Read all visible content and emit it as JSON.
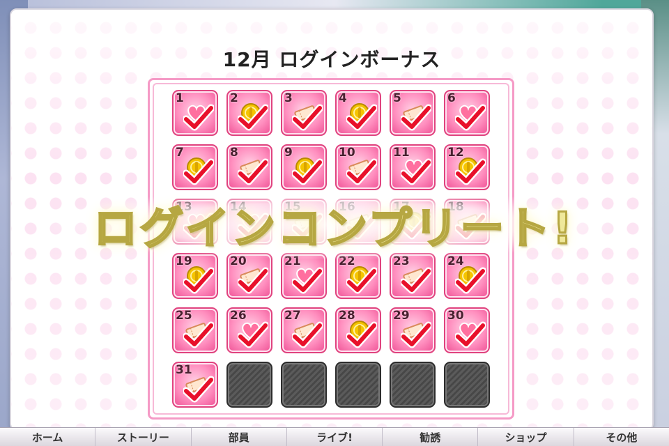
{
  "dialog": {
    "title": "12月 ログインボーナス"
  },
  "banner": {
    "text": "ログインコンプリート!"
  },
  "calendar": {
    "days": [
      {
        "day": "1",
        "reward": "heart-icon",
        "claimed": true
      },
      {
        "day": "2",
        "reward": "coin-icon",
        "claimed": true
      },
      {
        "day": "3",
        "reward": "ticket-icon",
        "claimed": true
      },
      {
        "day": "4",
        "reward": "coin-icon",
        "claimed": true
      },
      {
        "day": "5",
        "reward": "ticket-icon",
        "claimed": true
      },
      {
        "day": "6",
        "reward": "heart-icon",
        "claimed": true
      },
      {
        "day": "7",
        "reward": "coin-icon",
        "claimed": true
      },
      {
        "day": "8",
        "reward": "ticket-icon",
        "claimed": true
      },
      {
        "day": "9",
        "reward": "coin-icon",
        "claimed": true
      },
      {
        "day": "10",
        "reward": "ticket-icon",
        "claimed": true
      },
      {
        "day": "11",
        "reward": "heart-icon",
        "claimed": true
      },
      {
        "day": "12",
        "reward": "coin-icon",
        "claimed": true
      },
      {
        "day": "13",
        "reward": "heart-icon",
        "claimed": true
      },
      {
        "day": "14",
        "reward": "heart-icon",
        "claimed": true
      },
      {
        "day": "15",
        "reward": "ticket-icon",
        "claimed": true
      },
      {
        "day": "16",
        "reward": "ticket-icon",
        "claimed": true
      },
      {
        "day": "17",
        "reward": "coin-icon",
        "claimed": true
      },
      {
        "day": "18",
        "reward": "ticket-icon",
        "claimed": true
      },
      {
        "day": "19",
        "reward": "coin-icon",
        "claimed": true
      },
      {
        "day": "20",
        "reward": "ticket-icon",
        "claimed": true
      },
      {
        "day": "21",
        "reward": "heart-icon",
        "claimed": true
      },
      {
        "day": "22",
        "reward": "coin-icon",
        "claimed": true
      },
      {
        "day": "23",
        "reward": "ticket-icon",
        "claimed": true
      },
      {
        "day": "24",
        "reward": "coin-icon",
        "claimed": true
      },
      {
        "day": "25",
        "reward": "ticket-icon",
        "claimed": true
      },
      {
        "day": "26",
        "reward": "heart-icon",
        "claimed": true
      },
      {
        "day": "27",
        "reward": "ticket-icon",
        "claimed": true
      },
      {
        "day": "28",
        "reward": "coin-icon",
        "claimed": true
      },
      {
        "day": "29",
        "reward": "ticket-icon",
        "claimed": true
      },
      {
        "day": "30",
        "reward": "heart-icon",
        "claimed": true
      },
      {
        "day": "31",
        "reward": "ticket-icon",
        "claimed": true
      },
      {
        "day": "",
        "reward": "",
        "claimed": false,
        "locked": true
      },
      {
        "day": "",
        "reward": "",
        "claimed": false,
        "locked": true
      },
      {
        "day": "",
        "reward": "",
        "claimed": false,
        "locked": true
      },
      {
        "day": "",
        "reward": "",
        "claimed": false,
        "locked": true
      },
      {
        "day": "",
        "reward": "",
        "claimed": false,
        "locked": true
      }
    ]
  },
  "nav": {
    "items": [
      {
        "label": "ホーム"
      },
      {
        "label": "ストーリー"
      },
      {
        "label": "部員"
      },
      {
        "label": "ライブ!"
      },
      {
        "label": "勧誘"
      },
      {
        "label": "ショップ"
      },
      {
        "label": "その他"
      }
    ]
  },
  "colors": {
    "cell_pink": "#ff8fbf",
    "check_red": "#e8102a",
    "frame_pink": "#f59ac6",
    "banner_gold": "#efe89a"
  }
}
